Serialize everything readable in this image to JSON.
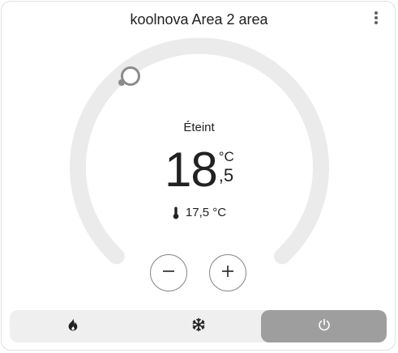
{
  "card": {
    "title": "koolnova Area 2 area"
  },
  "thermostat": {
    "mode_label": "Éteint",
    "target_integer": "18",
    "target_unit": "°C",
    "target_decimal": ",5",
    "current_temperature": "17,5 °C"
  },
  "icons": {
    "menu": "dots-vertical-icon",
    "thermometer": "thermometer-icon",
    "minus": "minus-icon",
    "plus": "plus-icon",
    "heat": "fire-icon",
    "cool": "snowflake-icon",
    "off": "power-icon"
  },
  "modes": [
    {
      "id": "heat",
      "icon": "fire-icon",
      "active": false
    },
    {
      "id": "cool",
      "icon": "snowflake-icon",
      "active": false
    },
    {
      "id": "off",
      "icon": "power-icon",
      "active": true
    }
  ],
  "colors": {
    "track": "#ebebeb",
    "active_mode": "#9e9e9e",
    "mode_bar": "#efefef",
    "text": "#212121"
  }
}
